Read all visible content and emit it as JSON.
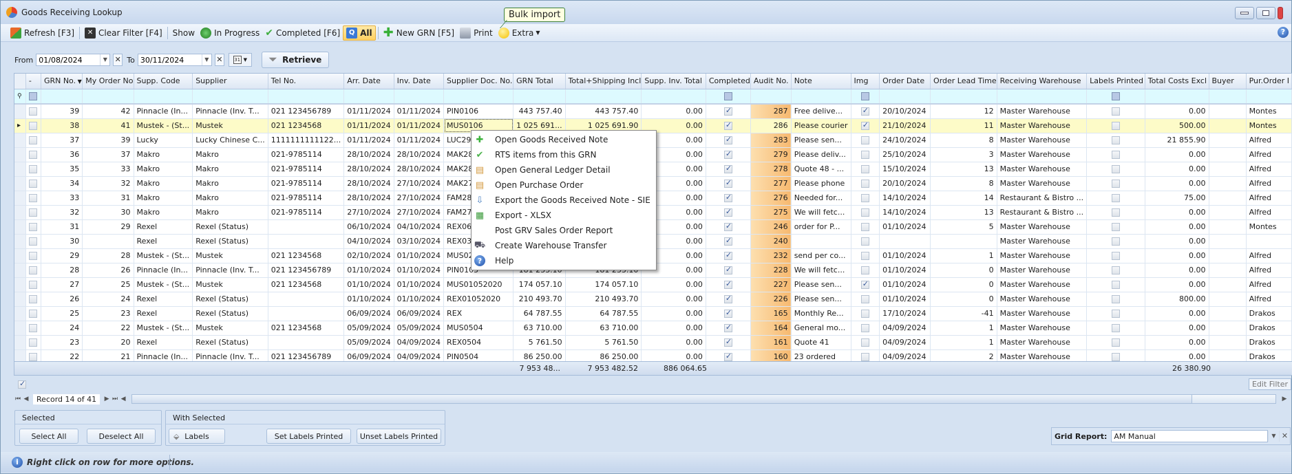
{
  "window": {
    "title": "Goods Receiving Lookup"
  },
  "toolbar": {
    "refresh": "Refresh [F3]",
    "clear_filter": "Clear Filter [F4]",
    "show_label": "Show",
    "in_progress": "In Progress",
    "completed": "Completed [F6]",
    "all": "All",
    "new_grn": "New GRN [F5]",
    "print": "Print",
    "extra": "Extra",
    "tooltip": "Bulk import"
  },
  "filter": {
    "from_label": "From",
    "from_value": "01/08/2024",
    "to_label": "To",
    "to_value": "30/11/2024",
    "retrieve": "Retrieve"
  },
  "grid": {
    "columns": [
      "-",
      "GRN No.",
      "My Order No",
      "Supp. Code",
      "Supplier",
      "Tel No.",
      "Arr. Date",
      "Inv. Date",
      "Supplier Doc. No.",
      "GRN Total",
      "Total+Shipping Incl",
      "Supp. Inv. Total",
      "Completed",
      "Audit No.",
      "Note",
      "Img",
      "Order Date",
      "Order Lead Time",
      "Receiving Warehouse",
      "Labels Printed",
      "Total Costs Excl",
      "Buyer",
      "Pur.Order I"
    ],
    "rows": [
      {
        "sel": false,
        "grn": "39",
        "order": "42",
        "code": "Pinnacle (In...",
        "supplier": "Pinnacle (Inv. T...",
        "tel": "021 123456789",
        "arr": "01/11/2024",
        "inv": "01/11/2024",
        "doc": "PIN0106",
        "total": "443 757.40",
        "ship": "443 757.40",
        "supp_inv": "0.00",
        "completed": true,
        "audit": "287",
        "note": "Free delive...",
        "img": true,
        "odate": "20/10/2024",
        "lead": "12",
        "wh": "Master Warehouse",
        "labels": false,
        "costs": "0.00",
        "buyer": "",
        "po": "Montes"
      },
      {
        "sel": false,
        "grn": "38",
        "order": "41",
        "code": "Mustek - (St...",
        "supplier": "Mustek",
        "tel": "021 1234568",
        "arr": "01/11/2024",
        "inv": "01/11/2024",
        "doc": "MUS0106",
        "total": "1 025 691...",
        "ship": "1 025 691.90",
        "supp_inv": "0.00",
        "completed": true,
        "audit": "286",
        "note": "Please courier",
        "img": true,
        "odate": "21/10/2024",
        "lead": "11",
        "wh": "Master Warehouse",
        "labels": false,
        "costs": "500.00",
        "buyer": "",
        "po": "Montes",
        "current": true
      },
      {
        "sel": false,
        "grn": "37",
        "order": "39",
        "code": "Lucky",
        "supplier": "Lucky Chinese C...",
        "tel": "1111111111122...",
        "arr": "01/11/2024",
        "inv": "01/11/2024",
        "doc": "LUC2905",
        "total": "",
        "ship": "",
        "supp_inv": "0.00",
        "completed": true,
        "audit": "283",
        "note": "Please sen...",
        "img": false,
        "odate": "24/10/2024",
        "lead": "8",
        "wh": "Master Warehouse",
        "labels": false,
        "costs": "21 855.90",
        "buyer": "",
        "po": "Alfred"
      },
      {
        "sel": false,
        "grn": "36",
        "order": "37",
        "code": "Makro",
        "supplier": "Makro",
        "tel": "021-9785114",
        "arr": "28/10/2024",
        "inv": "28/10/2024",
        "doc": "MAK2805-1",
        "total": "",
        "ship": "",
        "supp_inv": "0.00",
        "completed": true,
        "audit": "279",
        "note": "Please deliv...",
        "img": false,
        "odate": "25/10/2024",
        "lead": "3",
        "wh": "Master Warehouse",
        "labels": false,
        "costs": "0.00",
        "buyer": "",
        "po": "Alfred"
      },
      {
        "sel": false,
        "grn": "35",
        "order": "33",
        "code": "Makro",
        "supplier": "Makro",
        "tel": "021-9785114",
        "arr": "28/10/2024",
        "inv": "28/10/2024",
        "doc": "MAK2805",
        "total": "",
        "ship": "",
        "supp_inv": "0.00",
        "completed": true,
        "audit": "278",
        "note": "Quote 48 - ...",
        "img": false,
        "odate": "15/10/2024",
        "lead": "13",
        "wh": "Master Warehouse",
        "labels": false,
        "costs": "0.00",
        "buyer": "",
        "po": "Alfred"
      },
      {
        "sel": false,
        "grn": "34",
        "order": "32",
        "code": "Makro",
        "supplier": "Makro",
        "tel": "021-9785114",
        "arr": "28/10/2024",
        "inv": "27/10/2024",
        "doc": "MAK2705",
        "total": "",
        "ship": "",
        "supp_inv": "0.00",
        "completed": true,
        "audit": "277",
        "note": "Please phone",
        "img": false,
        "odate": "20/10/2024",
        "lead": "8",
        "wh": "Master Warehouse",
        "labels": false,
        "costs": "0.00",
        "buyer": "",
        "po": "Alfred"
      },
      {
        "sel": false,
        "grn": "33",
        "order": "31",
        "code": "Makro",
        "supplier": "Makro",
        "tel": "021-9785114",
        "arr": "28/10/2024",
        "inv": "27/10/2024",
        "doc": "FAM2805",
        "total": "",
        "ship": "",
        "supp_inv": "0.00",
        "completed": true,
        "audit": "276",
        "note": "Needed for...",
        "img": false,
        "odate": "14/10/2024",
        "lead": "14",
        "wh": "Restaurant & Bistro ...",
        "labels": false,
        "costs": "75.00",
        "buyer": "",
        "po": "Alfred"
      },
      {
        "sel": false,
        "grn": "32",
        "order": "30",
        "code": "Makro",
        "supplier": "Makro",
        "tel": "021-9785114",
        "arr": "27/10/2024",
        "inv": "27/10/2024",
        "doc": "FAM2705",
        "total": "",
        "ship": "",
        "supp_inv": "0.00",
        "completed": true,
        "audit": "275",
        "note": "We will fetc...",
        "img": false,
        "odate": "14/10/2024",
        "lead": "13",
        "wh": "Restaurant & Bistro ...",
        "labels": false,
        "costs": "0.00",
        "buyer": "",
        "po": "Alfred"
      },
      {
        "sel": false,
        "grn": "31",
        "order": "29",
        "code": "Rexel",
        "supplier": "Rexel (Status)",
        "tel": "",
        "arr": "06/10/2024",
        "inv": "04/10/2024",
        "doc": "REX0605",
        "total": "",
        "ship": "",
        "supp_inv": "0.00",
        "completed": true,
        "audit": "246",
        "note": "order for P...",
        "img": false,
        "odate": "01/10/2024",
        "lead": "5",
        "wh": "Master Warehouse",
        "labels": false,
        "costs": "0.00",
        "buyer": "",
        "po": "Montes"
      },
      {
        "sel": false,
        "grn": "30",
        "order": "",
        "code": "Rexel",
        "supplier": "Rexel (Status)",
        "tel": "",
        "arr": "04/10/2024",
        "inv": "03/10/2024",
        "doc": "REX0305",
        "total": "",
        "ship": "",
        "supp_inv": "0.00",
        "completed": true,
        "audit": "240",
        "note": "",
        "img": false,
        "odate": "",
        "lead": "",
        "wh": "Master Warehouse",
        "labels": false,
        "costs": "0.00",
        "buyer": "",
        "po": ""
      },
      {
        "sel": false,
        "grn": "29",
        "order": "28",
        "code": "Mustek - (St...",
        "supplier": "Mustek",
        "tel": "021 1234568",
        "arr": "02/10/2024",
        "inv": "01/10/2024",
        "doc": "MUS0205",
        "total": "",
        "ship": "",
        "supp_inv": "0.00",
        "completed": true,
        "audit": "232",
        "note": "send per co...",
        "img": false,
        "odate": "01/10/2024",
        "lead": "1",
        "wh": "Master Warehouse",
        "labels": false,
        "costs": "0.00",
        "buyer": "",
        "po": "Alfred"
      },
      {
        "sel": false,
        "grn": "28",
        "order": "26",
        "code": "Pinnacle (In...",
        "supplier": "Pinnacle (Inv. T...",
        "tel": "021 123456789",
        "arr": "01/10/2024",
        "inv": "01/10/2024",
        "doc": "PIN0105",
        "total": "181 233.10",
        "ship": "181 233.10",
        "supp_inv": "0.00",
        "completed": true,
        "audit": "228",
        "note": "We will fetc...",
        "img": false,
        "odate": "01/10/2024",
        "lead": "0",
        "wh": "Master Warehouse",
        "labels": false,
        "costs": "0.00",
        "buyer": "",
        "po": "Alfred"
      },
      {
        "sel": false,
        "grn": "27",
        "order": "25",
        "code": "Mustek - (St...",
        "supplier": "Mustek",
        "tel": "021 1234568",
        "arr": "01/10/2024",
        "inv": "01/10/2024",
        "doc": "MUS01052020",
        "total": "174 057.10",
        "ship": "174 057.10",
        "supp_inv": "0.00",
        "completed": true,
        "audit": "227",
        "note": "Please sen...",
        "img": true,
        "odate": "01/10/2024",
        "lead": "0",
        "wh": "Master Warehouse",
        "labels": false,
        "costs": "0.00",
        "buyer": "",
        "po": "Alfred"
      },
      {
        "sel": false,
        "grn": "26",
        "order": "24",
        "code": "Rexel",
        "supplier": "Rexel (Status)",
        "tel": "",
        "arr": "01/10/2024",
        "inv": "01/10/2024",
        "doc": "REX01052020",
        "total": "210 493.70",
        "ship": "210 493.70",
        "supp_inv": "0.00",
        "completed": true,
        "audit": "226",
        "note": "Please sen...",
        "img": false,
        "odate": "01/10/2024",
        "lead": "0",
        "wh": "Master Warehouse",
        "labels": false,
        "costs": "800.00",
        "buyer": "",
        "po": "Alfred"
      },
      {
        "sel": false,
        "grn": "25",
        "order": "23",
        "code": "Rexel",
        "supplier": "Rexel (Status)",
        "tel": "",
        "arr": "06/09/2024",
        "inv": "06/09/2024",
        "doc": "REX",
        "total": "64 787.55",
        "ship": "64 787.55",
        "supp_inv": "0.00",
        "completed": true,
        "audit": "165",
        "note": "Monthly Re...",
        "img": false,
        "odate": "17/10/2024",
        "lead": "-41",
        "wh": "Master Warehouse",
        "labels": false,
        "costs": "0.00",
        "buyer": "",
        "po": "Drakos"
      },
      {
        "sel": false,
        "grn": "24",
        "order": "22",
        "code": "Mustek - (St...",
        "supplier": "Mustek",
        "tel": "021 1234568",
        "arr": "05/09/2024",
        "inv": "05/09/2024",
        "doc": "MUS0504",
        "total": "63 710.00",
        "ship": "63 710.00",
        "supp_inv": "0.00",
        "completed": true,
        "audit": "164",
        "note": "General mo...",
        "img": false,
        "odate": "04/09/2024",
        "lead": "1",
        "wh": "Master Warehouse",
        "labels": false,
        "costs": "0.00",
        "buyer": "",
        "po": "Drakos"
      },
      {
        "sel": false,
        "grn": "23",
        "order": "20",
        "code": "Rexel",
        "supplier": "Rexel (Status)",
        "tel": "",
        "arr": "05/09/2024",
        "inv": "04/09/2024",
        "doc": "REX0504",
        "total": "5 761.50",
        "ship": "5 761.50",
        "supp_inv": "0.00",
        "completed": true,
        "audit": "161",
        "note": "Quote 41",
        "img": false,
        "odate": "04/09/2024",
        "lead": "1",
        "wh": "Master Warehouse",
        "labels": false,
        "costs": "0.00",
        "buyer": "",
        "po": "Drakos"
      },
      {
        "sel": false,
        "grn": "22",
        "order": "21",
        "code": "Pinnacle (In...",
        "supplier": "Pinnacle (Inv. T...",
        "tel": "021 123456789",
        "arr": "06/09/2024",
        "inv": "04/09/2024",
        "doc": "PIN0504",
        "total": "86 250.00",
        "ship": "86 250.00",
        "supp_inv": "0.00",
        "completed": true,
        "audit": "160",
        "note": "23 ordered",
        "img": false,
        "odate": "04/09/2024",
        "lead": "2",
        "wh": "Master Warehouse",
        "labels": false,
        "costs": "0.00",
        "buyer": "",
        "po": "Drakos"
      }
    ],
    "footer": {
      "grn_total": "7 953 48...",
      "ship_total": "7 953 482.52",
      "supp_inv_total": "886 064.65",
      "costs_total": "26 380.90"
    }
  },
  "context_menu": {
    "items": [
      {
        "label": "Open Goods Received Note",
        "icon": "green-plus-icon"
      },
      {
        "label": "RTS items from this GRN",
        "icon": "green-check-icon"
      },
      {
        "label": "Open General Ledger Detail",
        "icon": "ledger-icon"
      },
      {
        "label": "Open Purchase Order",
        "icon": "ledger-icon"
      },
      {
        "label": "Export the Goods Received Note - SIE",
        "icon": "export-icon"
      },
      {
        "label": "Export - XLSX",
        "icon": "excel-icon"
      },
      {
        "label": "Post GRV Sales Order Report",
        "icon": ""
      },
      {
        "label": "Create Warehouse Transfer",
        "icon": "truck-icon"
      },
      {
        "label": "Help",
        "icon": "help-icon"
      }
    ]
  },
  "edit_filter": "Edit Filter",
  "navigator": {
    "record": "Record 14 of 41"
  },
  "selected_group": {
    "title": "Selected",
    "select_all": "Select All",
    "deselect_all": "Deselect All"
  },
  "with_selected_group": {
    "title": "With Selected",
    "labels": "Labels",
    "set_printed": "Set Labels Printed",
    "unset_printed": "Unset Labels Printed"
  },
  "grid_report": {
    "label": "Grid Report:",
    "value": "AM Manual"
  },
  "status": {
    "message": "Right click on row for more options."
  }
}
